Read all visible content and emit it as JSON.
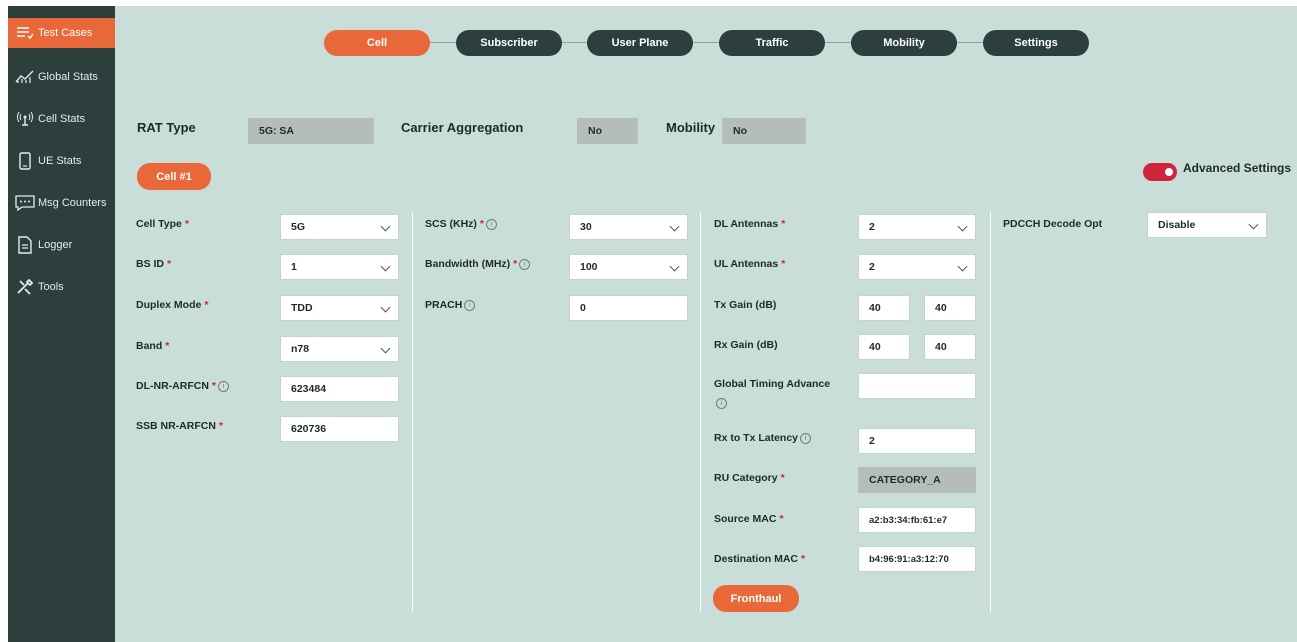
{
  "sidebar": {
    "items": [
      {
        "label": "Test Cases",
        "icon": "list-icon",
        "active": true
      },
      {
        "label": "Global Stats",
        "icon": "chart-icon"
      },
      {
        "label": "Cell Stats",
        "icon": "antenna-icon"
      },
      {
        "label": "UE Stats",
        "icon": "phone-icon"
      },
      {
        "label": "Msg Counters",
        "icon": "message-icon"
      },
      {
        "label": "Logger",
        "icon": "document-icon"
      },
      {
        "label": "Tools",
        "icon": "tools-icon"
      }
    ]
  },
  "tabs": [
    "Cell",
    "Subscriber",
    "User Plane",
    "Traffic",
    "Mobility",
    "Settings"
  ],
  "top": {
    "rat_type_label": "RAT Type",
    "rat_type_value": "5G: SA",
    "carrier_agg_label": "Carrier Aggregation",
    "carrier_agg_value": "No",
    "mobility_label": "Mobility",
    "mobility_value": "No"
  },
  "cell_button": "Cell #1",
  "advanced_settings": "Advanced Settings",
  "col1": {
    "cell_type": {
      "label": "Cell Type",
      "value": "5G"
    },
    "bs_id": {
      "label": "BS ID",
      "value": "1"
    },
    "duplex_mode": {
      "label": "Duplex Mode",
      "value": "TDD"
    },
    "band": {
      "label": "Band",
      "value": "n78"
    },
    "dl_nr_arfcn": {
      "label": "DL-NR-ARFCN",
      "value": "623484"
    },
    "ssb_nr_arfcn": {
      "label": "SSB NR-ARFCN",
      "value": "620736"
    }
  },
  "col2": {
    "scs": {
      "label": "SCS (KHz)",
      "value": "30"
    },
    "bandwidth": {
      "label": "Bandwidth (MHz)",
      "value": "100"
    },
    "prach": {
      "label": "PRACH",
      "value": "0"
    }
  },
  "col3": {
    "dl_antennas": {
      "label": "DL Antennas",
      "value": "2"
    },
    "ul_antennas": {
      "label": "UL Antennas",
      "value": "2"
    },
    "tx_gain": {
      "label": "Tx Gain (dB)",
      "value1": "40",
      "value2": "40"
    },
    "rx_gain": {
      "label": "Rx Gain (dB)",
      "value1": "40",
      "value2": "40"
    },
    "global_timing_advance": {
      "label": "Global Timing Advance",
      "value": ""
    },
    "rx_tx_latency": {
      "label": "Rx to Tx Latency",
      "value": "2"
    },
    "ru_category": {
      "label": "RU Category",
      "value": "CATEGORY_A"
    },
    "source_mac": {
      "label": "Source MAC",
      "value": "a2:b3:34:fb:61:e7"
    },
    "dest_mac": {
      "label": "Destination MAC",
      "value": "b4:96:91:a3:12:70"
    },
    "fronthaul_button": "Fronthaul"
  },
  "col4": {
    "pdcch_decode": {
      "label": "PDCCH Decode Opt",
      "value": "Disable"
    }
  },
  "info_glyph": "i",
  "required_mark": "*",
  "colors": {
    "accent": "#e8683a",
    "sidebar": "#2c3f3c",
    "background": "#c9ded8",
    "required": "#d0243a"
  }
}
